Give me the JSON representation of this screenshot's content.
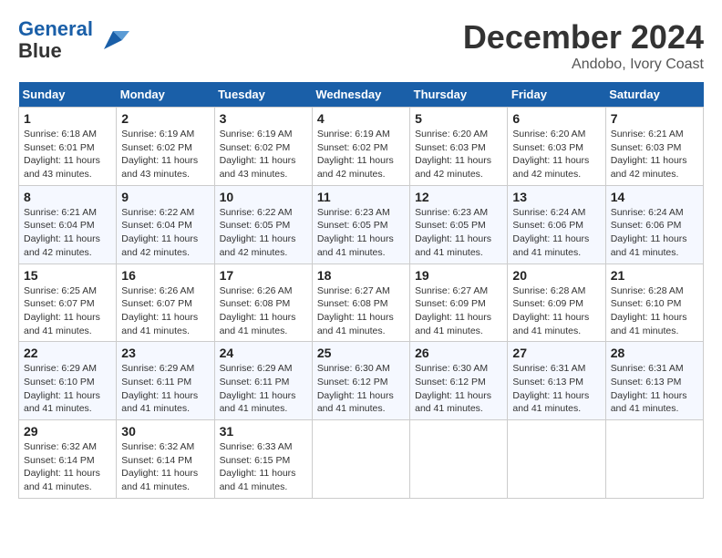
{
  "header": {
    "logo_line1": "General",
    "logo_line2": "Blue",
    "month": "December 2024",
    "location": "Andobo, Ivory Coast"
  },
  "weekdays": [
    "Sunday",
    "Monday",
    "Tuesday",
    "Wednesday",
    "Thursday",
    "Friday",
    "Saturday"
  ],
  "weeks": [
    [
      {
        "day": "1",
        "sunrise": "6:18 AM",
        "sunset": "6:01 PM",
        "daylight": "11 hours and 43 minutes."
      },
      {
        "day": "2",
        "sunrise": "6:19 AM",
        "sunset": "6:02 PM",
        "daylight": "11 hours and 43 minutes."
      },
      {
        "day": "3",
        "sunrise": "6:19 AM",
        "sunset": "6:02 PM",
        "daylight": "11 hours and 43 minutes."
      },
      {
        "day": "4",
        "sunrise": "6:19 AM",
        "sunset": "6:02 PM",
        "daylight": "11 hours and 42 minutes."
      },
      {
        "day": "5",
        "sunrise": "6:20 AM",
        "sunset": "6:03 PM",
        "daylight": "11 hours and 42 minutes."
      },
      {
        "day": "6",
        "sunrise": "6:20 AM",
        "sunset": "6:03 PM",
        "daylight": "11 hours and 42 minutes."
      },
      {
        "day": "7",
        "sunrise": "6:21 AM",
        "sunset": "6:03 PM",
        "daylight": "11 hours and 42 minutes."
      }
    ],
    [
      {
        "day": "8",
        "sunrise": "6:21 AM",
        "sunset": "6:04 PM",
        "daylight": "11 hours and 42 minutes."
      },
      {
        "day": "9",
        "sunrise": "6:22 AM",
        "sunset": "6:04 PM",
        "daylight": "11 hours and 42 minutes."
      },
      {
        "day": "10",
        "sunrise": "6:22 AM",
        "sunset": "6:05 PM",
        "daylight": "11 hours and 42 minutes."
      },
      {
        "day": "11",
        "sunrise": "6:23 AM",
        "sunset": "6:05 PM",
        "daylight": "11 hours and 41 minutes."
      },
      {
        "day": "12",
        "sunrise": "6:23 AM",
        "sunset": "6:05 PM",
        "daylight": "11 hours and 41 minutes."
      },
      {
        "day": "13",
        "sunrise": "6:24 AM",
        "sunset": "6:06 PM",
        "daylight": "11 hours and 41 minutes."
      },
      {
        "day": "14",
        "sunrise": "6:24 AM",
        "sunset": "6:06 PM",
        "daylight": "11 hours and 41 minutes."
      }
    ],
    [
      {
        "day": "15",
        "sunrise": "6:25 AM",
        "sunset": "6:07 PM",
        "daylight": "11 hours and 41 minutes."
      },
      {
        "day": "16",
        "sunrise": "6:26 AM",
        "sunset": "6:07 PM",
        "daylight": "11 hours and 41 minutes."
      },
      {
        "day": "17",
        "sunrise": "6:26 AM",
        "sunset": "6:08 PM",
        "daylight": "11 hours and 41 minutes."
      },
      {
        "day": "18",
        "sunrise": "6:27 AM",
        "sunset": "6:08 PM",
        "daylight": "11 hours and 41 minutes."
      },
      {
        "day": "19",
        "sunrise": "6:27 AM",
        "sunset": "6:09 PM",
        "daylight": "11 hours and 41 minutes."
      },
      {
        "day": "20",
        "sunrise": "6:28 AM",
        "sunset": "6:09 PM",
        "daylight": "11 hours and 41 minutes."
      },
      {
        "day": "21",
        "sunrise": "6:28 AM",
        "sunset": "6:10 PM",
        "daylight": "11 hours and 41 minutes."
      }
    ],
    [
      {
        "day": "22",
        "sunrise": "6:29 AM",
        "sunset": "6:10 PM",
        "daylight": "11 hours and 41 minutes."
      },
      {
        "day": "23",
        "sunrise": "6:29 AM",
        "sunset": "6:11 PM",
        "daylight": "11 hours and 41 minutes."
      },
      {
        "day": "24",
        "sunrise": "6:29 AM",
        "sunset": "6:11 PM",
        "daylight": "11 hours and 41 minutes."
      },
      {
        "day": "25",
        "sunrise": "6:30 AM",
        "sunset": "6:12 PM",
        "daylight": "11 hours and 41 minutes."
      },
      {
        "day": "26",
        "sunrise": "6:30 AM",
        "sunset": "6:12 PM",
        "daylight": "11 hours and 41 minutes."
      },
      {
        "day": "27",
        "sunrise": "6:31 AM",
        "sunset": "6:13 PM",
        "daylight": "11 hours and 41 minutes."
      },
      {
        "day": "28",
        "sunrise": "6:31 AM",
        "sunset": "6:13 PM",
        "daylight": "11 hours and 41 minutes."
      }
    ],
    [
      {
        "day": "29",
        "sunrise": "6:32 AM",
        "sunset": "6:14 PM",
        "daylight": "11 hours and 41 minutes."
      },
      {
        "day": "30",
        "sunrise": "6:32 AM",
        "sunset": "6:14 PM",
        "daylight": "11 hours and 41 minutes."
      },
      {
        "day": "31",
        "sunrise": "6:33 AM",
        "sunset": "6:15 PM",
        "daylight": "11 hours and 41 minutes."
      },
      null,
      null,
      null,
      null
    ]
  ]
}
